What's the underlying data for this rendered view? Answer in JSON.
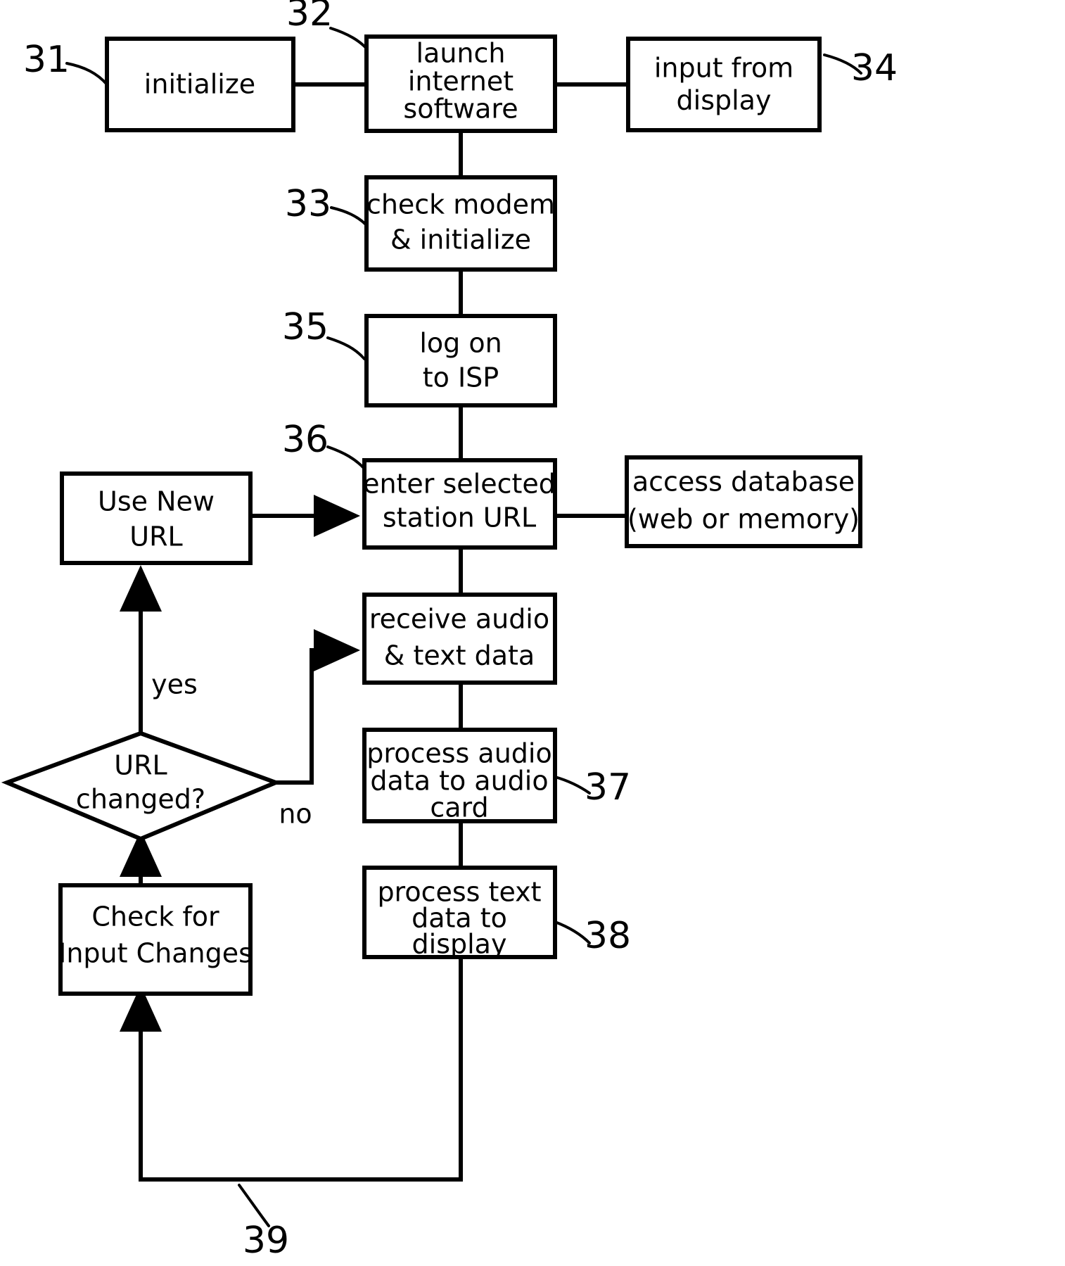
{
  "figure": {
    "type": "patent-flowchart",
    "background_color": "#ffffff",
    "line_color": "#000000"
  },
  "nodes": {
    "initialize": {
      "ref": "31",
      "lines": [
        "initialize"
      ],
      "shape": "rectangle"
    },
    "launch_internet_software": {
      "ref": "32",
      "lines": [
        "launch",
        "internet",
        "software"
      ],
      "shape": "rectangle"
    },
    "input_from_display": {
      "ref": "34",
      "lines": [
        "input from",
        "display"
      ],
      "shape": "rectangle"
    },
    "check_modem": {
      "ref": "33",
      "lines": [
        "check modem",
        "& initialize"
      ],
      "shape": "rectangle"
    },
    "log_on_to_isp": {
      "ref": "35",
      "lines": [
        "log on",
        "to ISP"
      ],
      "shape": "rectangle"
    },
    "enter_station_url": {
      "ref": "36",
      "lines": [
        "enter selected",
        "station URL"
      ],
      "shape": "rectangle"
    },
    "access_database": {
      "ref": "",
      "lines": [
        "access database",
        "(web or memory)"
      ],
      "shape": "rectangle"
    },
    "use_new_url": {
      "ref": "",
      "lines": [
        "Use New",
        "URL"
      ],
      "shape": "rectangle"
    },
    "receive_audio_text": {
      "ref": "",
      "lines": [
        "receive audio",
        "& text data"
      ],
      "shape": "rectangle"
    },
    "process_audio": {
      "ref": "37",
      "lines": [
        "process audio",
        "data to audio",
        "card"
      ],
      "shape": "rectangle"
    },
    "process_text": {
      "ref": "38",
      "lines": [
        "process text",
        "data to",
        "display"
      ],
      "shape": "rectangle"
    },
    "url_changed": {
      "ref": "",
      "lines": [
        "URL",
        "changed?"
      ],
      "shape": "diamond"
    },
    "check_input_changes": {
      "ref": "",
      "lines": [
        "Check for",
        "Input Changes"
      ],
      "shape": "rectangle"
    }
  },
  "edge_labels": {
    "yes": "yes",
    "no": "no",
    "feedback_loop": "39"
  },
  "reference_numerals": {
    "n31": "31",
    "n32": "32",
    "n33": "33",
    "n34": "34",
    "n35": "35",
    "n36": "36",
    "n37": "37",
    "n38": "38",
    "n39": "39"
  }
}
